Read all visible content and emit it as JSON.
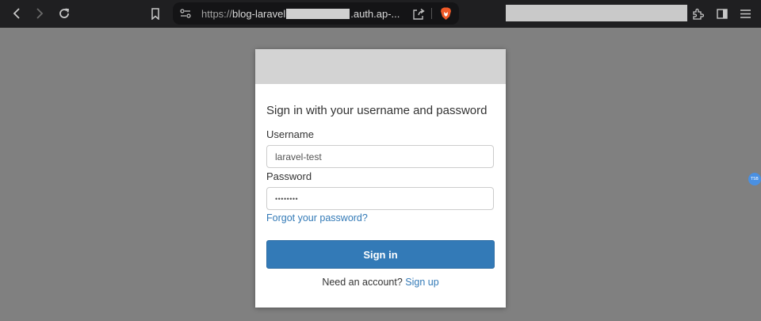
{
  "browser": {
    "url_scheme": "https://",
    "url_host_start": "blog-laravel",
    "url_host_end": ".auth.ap-...",
    "accent_shield": "#f25a28"
  },
  "indicator": {
    "label": "TSB",
    "color": "#4a90e2"
  },
  "login": {
    "heading": "Sign in with your username and password",
    "username_label": "Username",
    "username_value": "laravel-test",
    "password_label": "Password",
    "password_value": "••••••••",
    "forgot_link": "Forgot your password?",
    "signin_button": "Sign in",
    "signup_prompt": "Need an account?",
    "signup_link": "Sign up",
    "button_color": "#337ab7",
    "link_color": "#337ab7"
  }
}
